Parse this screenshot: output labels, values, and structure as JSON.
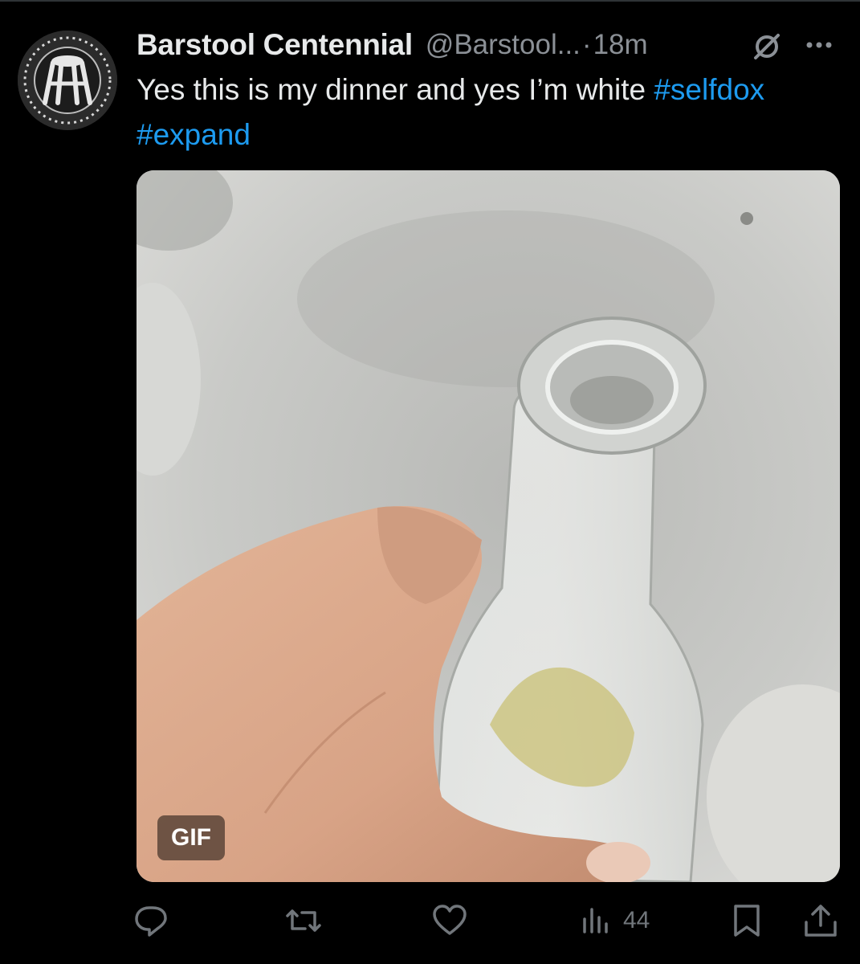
{
  "tweet": {
    "display_name": "Barstool Centennial",
    "handle": "@Barstool...",
    "separator": "·",
    "time": "18m",
    "text": "Yes this is my dinner and yes I’m white ",
    "hashtags": [
      "#selfdox",
      "#expand"
    ]
  },
  "media": {
    "badge": "GIF"
  },
  "actions": {
    "views": "44",
    "icons": [
      "reply-icon",
      "retweet-icon",
      "like-icon",
      "views-icon",
      "bookmark-icon",
      "share-icon"
    ]
  },
  "colors": {
    "background": "#000000",
    "text": "#e7e9ea",
    "secondary": "#71767b",
    "link": "#1d9bf0"
  }
}
